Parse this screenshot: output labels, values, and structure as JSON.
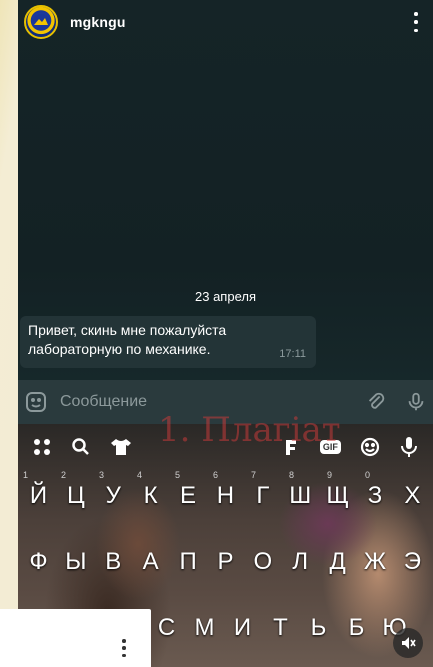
{
  "header": {
    "username": "mgkngu"
  },
  "chat": {
    "date": "23 апреля",
    "message": {
      "text_line1": "Привет, скинь мне пожалуйста",
      "text_line2": "лабораторную по механике.",
      "time": "17:11"
    },
    "input_placeholder": "Сообщение"
  },
  "overlay": {
    "caption": "1. Плагіат"
  },
  "keyboard": {
    "toolbar": [
      "apps-icon",
      "search-icon",
      "shirt-icon",
      "clipboard-icon",
      "gif-icon",
      "emoji-icon",
      "mic-icon"
    ],
    "toolbar_gif": "GIF",
    "digits": [
      "1",
      "2",
      "3",
      "4",
      "5",
      "6",
      "7",
      "8",
      "9",
      "0"
    ],
    "row1": [
      "Й",
      "Ц",
      "У",
      "К",
      "Е",
      "Н",
      "Г",
      "Ш",
      "Щ",
      "З",
      "Х"
    ],
    "row2": [
      "Ф",
      "Ы",
      "В",
      "А",
      "П",
      "Р",
      "О",
      "Л",
      "Д",
      "Ж",
      "Э"
    ],
    "row3": [
      "С",
      "М",
      "И",
      "Т",
      "Ь",
      "Б",
      "Ю"
    ]
  },
  "colors": {
    "background": "#132124",
    "bubble": "#233437",
    "input_bar": "#2a3a3d",
    "accent_red": "#c43a3a"
  }
}
